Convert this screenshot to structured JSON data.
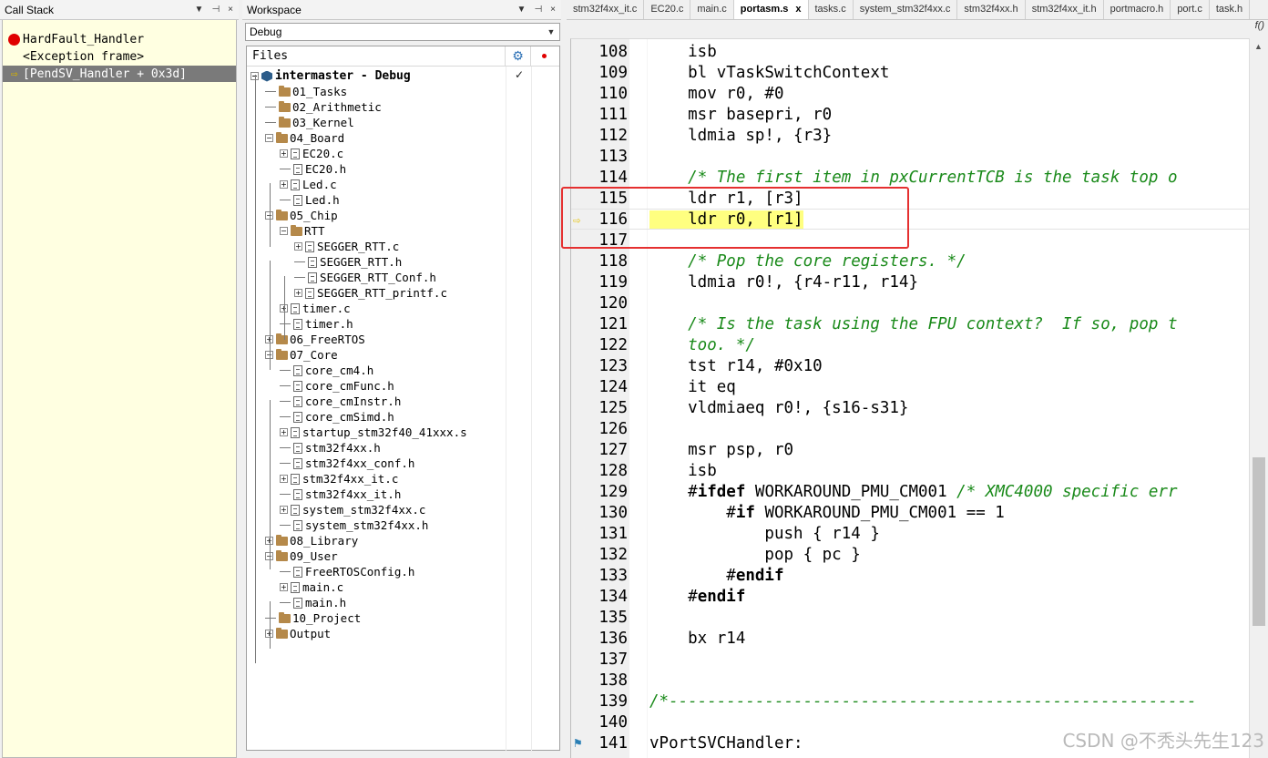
{
  "callstack": {
    "title": "Call Stack",
    "controls": [
      "▼",
      "⊣",
      "×"
    ],
    "frames": [
      {
        "label": "HardFault_Handler",
        "marker": "breakpoint"
      },
      {
        "label": "<Exception frame>",
        "marker": "none"
      },
      {
        "label": "[PendSV_Handler + 0x3d]",
        "marker": "current",
        "selected": true
      }
    ]
  },
  "workspace": {
    "title": "Workspace",
    "controls": [
      "▼",
      "⊣",
      "×"
    ],
    "configuration": "Debug",
    "files_header": "Files",
    "tree": [
      {
        "label": "intermaster - Debug",
        "type": "project",
        "depth": 0,
        "exp": "-",
        "root": true
      },
      {
        "label": "01_Tasks",
        "type": "folder",
        "depth": 1,
        "exp": ""
      },
      {
        "label": "02_Arithmetic",
        "type": "folder",
        "depth": 1,
        "exp": ""
      },
      {
        "label": "03_Kernel",
        "type": "folder",
        "depth": 1,
        "exp": ""
      },
      {
        "label": "04_Board",
        "type": "folder",
        "depth": 1,
        "exp": "-"
      },
      {
        "label": "EC20.c",
        "type": "file",
        "depth": 2,
        "exp": "+"
      },
      {
        "label": "EC20.h",
        "type": "file",
        "depth": 2,
        "exp": ""
      },
      {
        "label": "Led.c",
        "type": "file",
        "depth": 2,
        "exp": "+"
      },
      {
        "label": "Led.h",
        "type": "file",
        "depth": 2,
        "exp": ""
      },
      {
        "label": "05_Chip",
        "type": "folder",
        "depth": 1,
        "exp": "-"
      },
      {
        "label": "RTT",
        "type": "folder",
        "depth": 2,
        "exp": "-"
      },
      {
        "label": "SEGGER_RTT.c",
        "type": "file",
        "depth": 3,
        "exp": "+"
      },
      {
        "label": "SEGGER_RTT.h",
        "type": "file",
        "depth": 3,
        "exp": ""
      },
      {
        "label": "SEGGER_RTT_Conf.h",
        "type": "file",
        "depth": 3,
        "exp": ""
      },
      {
        "label": "SEGGER_RTT_printf.c",
        "type": "file",
        "depth": 3,
        "exp": "+"
      },
      {
        "label": "timer.c",
        "type": "file",
        "depth": 2,
        "exp": "+"
      },
      {
        "label": "timer.h",
        "type": "file",
        "depth": 2,
        "exp": ""
      },
      {
        "label": "06_FreeRTOS",
        "type": "folder",
        "depth": 1,
        "exp": "+"
      },
      {
        "label": "07_Core",
        "type": "folder",
        "depth": 1,
        "exp": "-"
      },
      {
        "label": "core_cm4.h",
        "type": "file",
        "depth": 2,
        "exp": ""
      },
      {
        "label": "core_cmFunc.h",
        "type": "file",
        "depth": 2,
        "exp": ""
      },
      {
        "label": "core_cmInstr.h",
        "type": "file",
        "depth": 2,
        "exp": ""
      },
      {
        "label": "core_cmSimd.h",
        "type": "file",
        "depth": 2,
        "exp": ""
      },
      {
        "label": "startup_stm32f40_41xxx.s",
        "type": "file",
        "depth": 2,
        "exp": "+"
      },
      {
        "label": "stm32f4xx.h",
        "type": "file",
        "depth": 2,
        "exp": ""
      },
      {
        "label": "stm32f4xx_conf.h",
        "type": "file",
        "depth": 2,
        "exp": ""
      },
      {
        "label": "stm32f4xx_it.c",
        "type": "file",
        "depth": 2,
        "exp": "+"
      },
      {
        "label": "stm32f4xx_it.h",
        "type": "file",
        "depth": 2,
        "exp": ""
      },
      {
        "label": "system_stm32f4xx.c",
        "type": "file",
        "depth": 2,
        "exp": "+"
      },
      {
        "label": "system_stm32f4xx.h",
        "type": "file",
        "depth": 2,
        "exp": ""
      },
      {
        "label": "08_Library",
        "type": "folder",
        "depth": 1,
        "exp": "+"
      },
      {
        "label": "09_User",
        "type": "folder",
        "depth": 1,
        "exp": "-"
      },
      {
        "label": "FreeRTOSConfig.h",
        "type": "file",
        "depth": 2,
        "exp": ""
      },
      {
        "label": "main.c",
        "type": "file",
        "depth": 2,
        "exp": "+"
      },
      {
        "label": "main.h",
        "type": "file",
        "depth": 2,
        "exp": ""
      },
      {
        "label": "10_Project",
        "type": "folder",
        "depth": 1,
        "exp": ""
      },
      {
        "label": "Output",
        "type": "folder",
        "depth": 1,
        "exp": "+"
      }
    ]
  },
  "editor": {
    "tabs": [
      {
        "label": "stm32f4xx_it.c"
      },
      {
        "label": "EC20.c"
      },
      {
        "label": "main.c"
      },
      {
        "label": "portasm.s",
        "active": true
      },
      {
        "label": "tasks.c"
      },
      {
        "label": "system_stm32f4xx.c"
      },
      {
        "label": "stm32f4xx.h"
      },
      {
        "label": "stm32f4xx_it.h"
      },
      {
        "label": "portmacro.h"
      },
      {
        "label": "port.c"
      },
      {
        "label": "task.h"
      }
    ],
    "close_glyph": "x",
    "func_icon": "f()",
    "lines": [
      {
        "n": "108",
        "parts": [
          [
            "",
            "    isb"
          ]
        ]
      },
      {
        "n": "109",
        "parts": [
          [
            "",
            "    bl vTaskSwitchContext"
          ]
        ]
      },
      {
        "n": "110",
        "parts": [
          [
            "",
            "    mov r0, #0"
          ]
        ]
      },
      {
        "n": "111",
        "parts": [
          [
            "",
            "    msr basepri, r0"
          ]
        ]
      },
      {
        "n": "112",
        "parts": [
          [
            "",
            "    ldmia sp!, {r3}"
          ]
        ]
      },
      {
        "n": "113",
        "parts": []
      },
      {
        "n": "114",
        "parts": [
          [
            "",
            "    "
          ],
          [
            "cm",
            "/* The first item in pxCurrentTCB is the task top o"
          ]
        ]
      },
      {
        "n": "115",
        "parts": [
          [
            "",
            "    ldr r1, [r3]"
          ]
        ]
      },
      {
        "n": "116",
        "parts": [
          [
            "hl",
            "    ldr r0, [r1]"
          ]
        ],
        "current": true,
        "marker": "arrow"
      },
      {
        "n": "117",
        "parts": []
      },
      {
        "n": "118",
        "parts": [
          [
            "",
            "    "
          ],
          [
            "cm",
            "/* Pop the core registers. */"
          ]
        ]
      },
      {
        "n": "119",
        "parts": [
          [
            "",
            "    ldmia r0!, {r4-r11, r14}"
          ]
        ]
      },
      {
        "n": "120",
        "parts": []
      },
      {
        "n": "121",
        "parts": [
          [
            "",
            "    "
          ],
          [
            "cm",
            "/* Is the task using the FPU context?  If so, pop t"
          ]
        ]
      },
      {
        "n": "122",
        "parts": [
          [
            "cm",
            "    too. */"
          ]
        ]
      },
      {
        "n": "123",
        "parts": [
          [
            "",
            "    tst r14, #0x10"
          ]
        ]
      },
      {
        "n": "124",
        "parts": [
          [
            "",
            "    it eq"
          ]
        ]
      },
      {
        "n": "125",
        "parts": [
          [
            "",
            "    vldmiaeq r0!, {s16-s31}"
          ]
        ]
      },
      {
        "n": "126",
        "parts": []
      },
      {
        "n": "127",
        "parts": [
          [
            "",
            "    msr psp, r0"
          ]
        ]
      },
      {
        "n": "128",
        "parts": [
          [
            "",
            "    isb"
          ]
        ]
      },
      {
        "n": "129",
        "parts": [
          [
            "",
            "    #"
          ],
          [
            "kw",
            "ifdef"
          ],
          [
            "",
            " WORKAROUND_PMU_CM001 "
          ],
          [
            "cm",
            "/* XMC4000 specific err"
          ]
        ]
      },
      {
        "n": "130",
        "parts": [
          [
            "",
            "        #"
          ],
          [
            "kw",
            "if"
          ],
          [
            "",
            " WORKAROUND_PMU_CM001 == 1"
          ]
        ]
      },
      {
        "n": "131",
        "parts": [
          [
            "",
            "            push { r14 }"
          ]
        ]
      },
      {
        "n": "132",
        "parts": [
          [
            "",
            "            pop { pc }"
          ]
        ]
      },
      {
        "n": "133",
        "parts": [
          [
            "",
            "        #"
          ],
          [
            "kw",
            "endif"
          ]
        ]
      },
      {
        "n": "134",
        "parts": [
          [
            "",
            "    #"
          ],
          [
            "kw",
            "endif"
          ]
        ]
      },
      {
        "n": "135",
        "parts": []
      },
      {
        "n": "136",
        "parts": [
          [
            "",
            "    bx r14"
          ]
        ]
      },
      {
        "n": "137",
        "parts": []
      },
      {
        "n": "138",
        "parts": []
      },
      {
        "n": "139",
        "parts": [
          [
            "cm",
            "/*-------------------------------------------------------"
          ]
        ]
      },
      {
        "n": "140",
        "parts": []
      },
      {
        "n": "141",
        "parts": [
          [
            "",
            "vPortSVCHandler:"
          ]
        ],
        "marker": "bookmark"
      }
    ]
  },
  "watermark": "CSDN @不秃头先生123",
  "colors": {
    "highlight": "#ffff80",
    "comment": "#1a8a1a",
    "callout_box": "#e53030",
    "callstack_bg": "#ffffe1",
    "breakpoint": "#e00000"
  }
}
